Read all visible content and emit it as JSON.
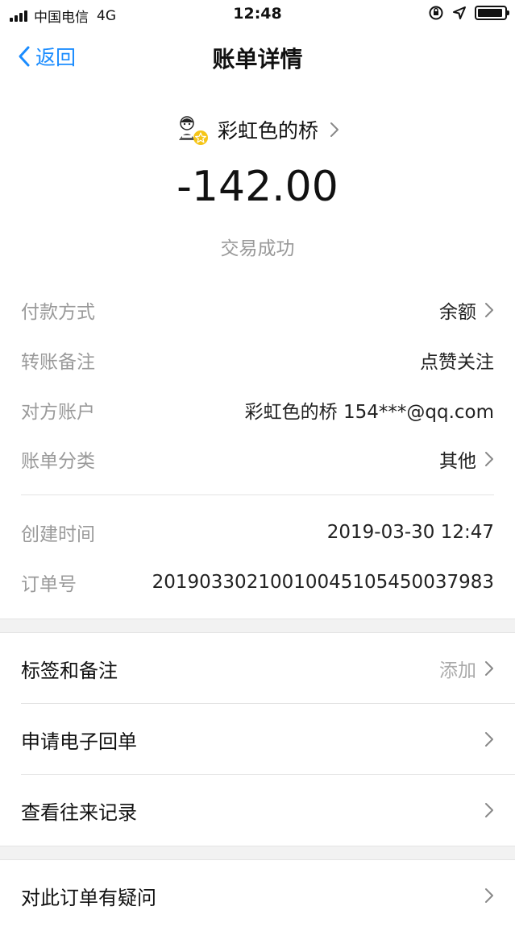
{
  "status_bar": {
    "carrier": "中国电信",
    "network": "4G",
    "time": "12:48",
    "battery_level": 0.95
  },
  "nav": {
    "back_label": "返回",
    "title": "账单详情"
  },
  "header": {
    "payee_name": "彩虹色的桥",
    "amount": "-142.00",
    "status": "交易成功"
  },
  "details": [
    {
      "label": "付款方式",
      "value": "余额",
      "has_chevron": true
    },
    {
      "label": "转账备注",
      "value": "点赞关注",
      "has_chevron": false
    },
    {
      "label": "对方账户",
      "value": "彩虹色的桥 154***@qq.com",
      "has_chevron": false
    },
    {
      "label": "账单分类",
      "value": "其他",
      "has_chevron": true
    }
  ],
  "details2": [
    {
      "label": "创建时间",
      "value": "2019-03-30 12:47"
    },
    {
      "label": "订单号",
      "value": "20190330210010045105450037983"
    }
  ],
  "menu": [
    {
      "label": "标签和备注",
      "hint": "添加"
    },
    {
      "label": "申请电子回单",
      "hint": ""
    },
    {
      "label": "查看往来记录",
      "hint": ""
    }
  ],
  "menu2": [
    {
      "label": "对此订单有疑问",
      "hint": ""
    }
  ],
  "colors": {
    "accent": "#1a8cff",
    "label_gray": "#9a9a9a",
    "section_gap": "#f2f2f2"
  }
}
